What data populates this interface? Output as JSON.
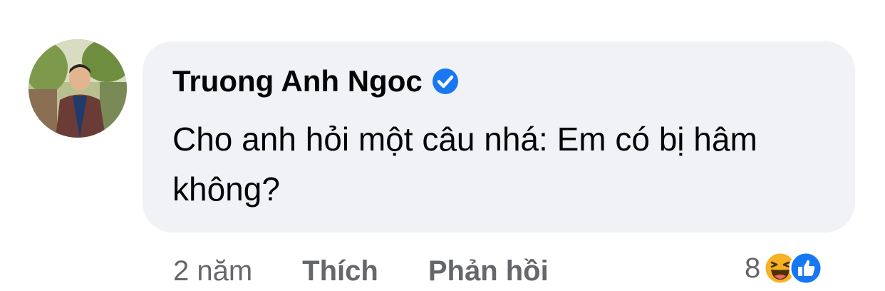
{
  "comment": {
    "author": "Truong Anh Ngoc",
    "verified_icon": "verified-badge-icon",
    "text": "Cho anh hỏi một câu nhá: Em có bị hâm không?",
    "avatar_icon": "profile-photo"
  },
  "actions": {
    "time": "2 năm",
    "like_label": "Thích",
    "reply_label": "Phản hồi"
  },
  "reactions": {
    "count": "8",
    "icons": [
      "haha-reaction-icon",
      "like-reaction-icon"
    ]
  },
  "colors": {
    "bubble": "#f0f2f5",
    "verified": "#1877f2",
    "meta_text": "#65676b",
    "like_blue": "#1877f2",
    "haha_yellow": "#f7b125"
  }
}
